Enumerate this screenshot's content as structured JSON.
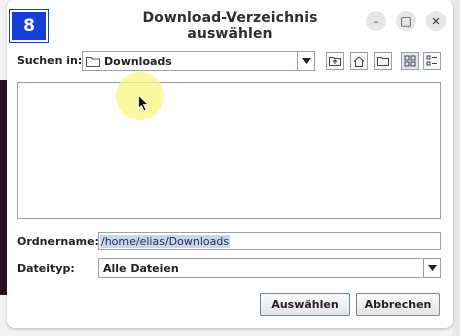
{
  "step_badge": "8",
  "window": {
    "title": "Download-Verzeichnis auswählen",
    "minimize": "–",
    "maximize": "□",
    "close": "✕"
  },
  "look_in": {
    "label": "Suchen in:",
    "value": "Downloads"
  },
  "toolbar": {
    "icons": [
      "up-folder-icon",
      "home-icon",
      "new-folder-icon",
      "list-view-icon",
      "details-view-icon"
    ]
  },
  "folder_name": {
    "label": "Ordnername:",
    "value": "/home/elias/Downloads"
  },
  "file_type": {
    "label": "Dateityp:",
    "value": "Alle Dateien"
  },
  "buttons": {
    "select": "Auswählen",
    "cancel": "Abbrechen"
  },
  "colors": {
    "badge": "#1540d8",
    "selection": "#c7d7f0",
    "highlight": "#faf582"
  }
}
